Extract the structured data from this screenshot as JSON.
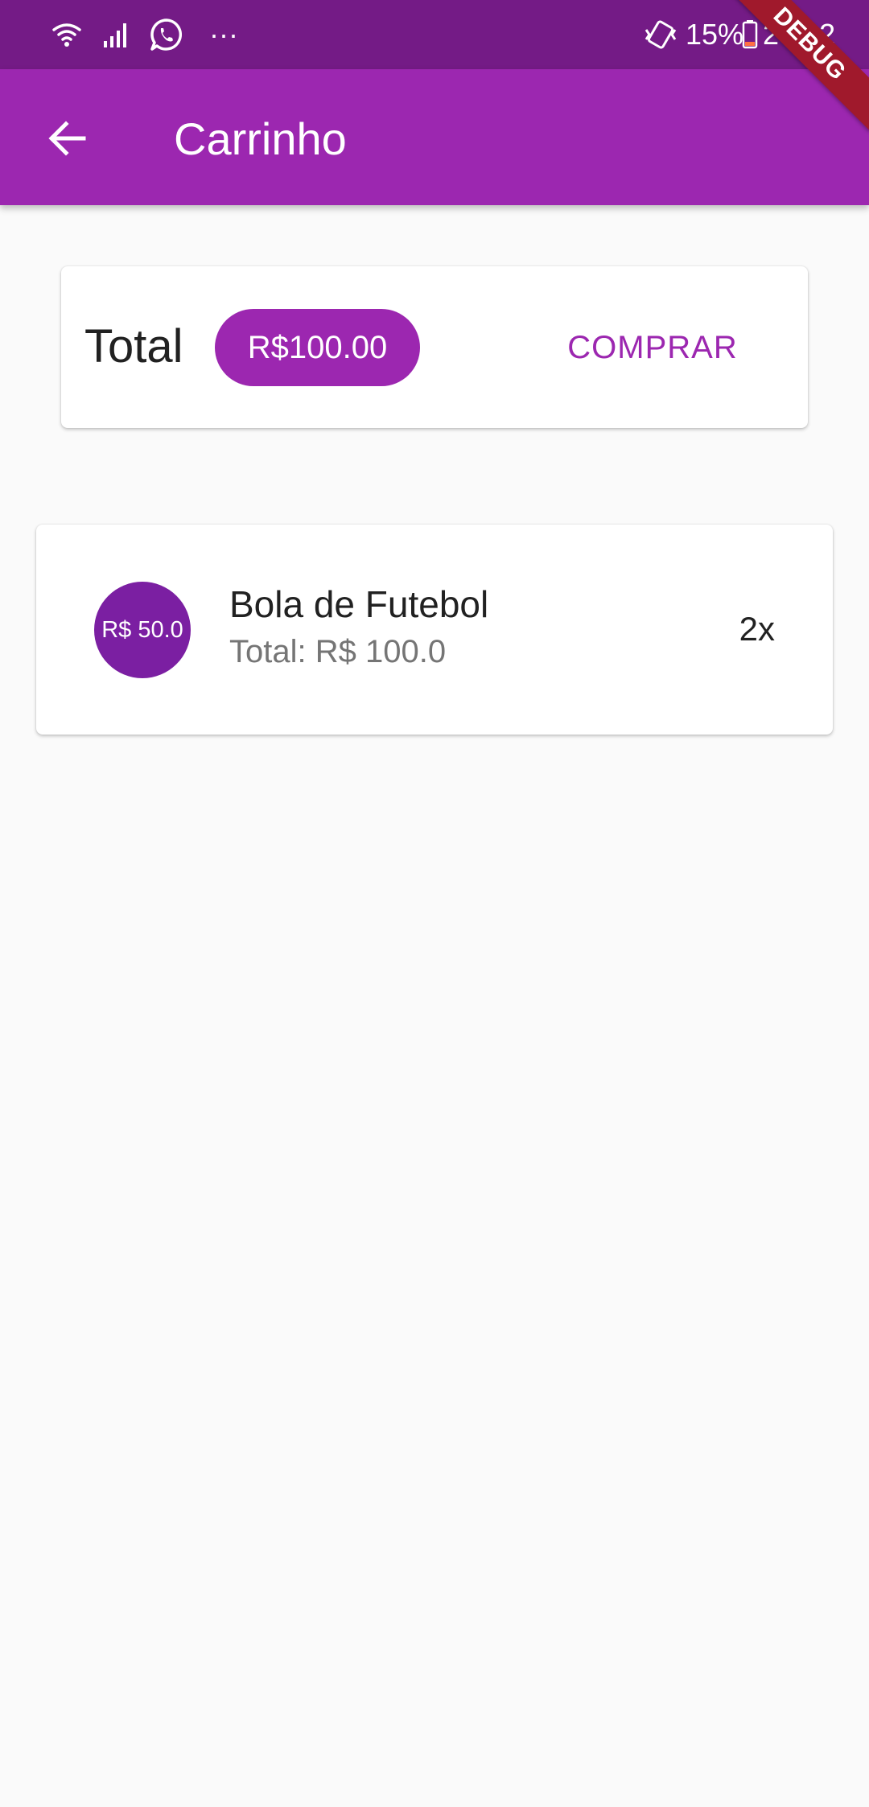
{
  "status_bar": {
    "icons": [
      "wifi-icon",
      "signal-icon",
      "whatsapp-icon",
      "more-notifications-icon",
      "vibrate-icon",
      "battery-icon"
    ],
    "more_indicator": "···",
    "battery_percent": "15%",
    "time": "20:32"
  },
  "debug_banner": "DEBUG",
  "app_bar": {
    "back_icon": "arrow-back-icon",
    "title": "Carrinho"
  },
  "total_card": {
    "label": "Total",
    "amount": "R$100.00",
    "buy_label": "COMPRAR"
  },
  "cart_items": [
    {
      "price_badge": "R$ 50.0",
      "name": "Bola de Futebol",
      "subtotal": "Total: R$ 100.0",
      "quantity": "2x"
    }
  ],
  "colors": {
    "primary": "#9c27b0",
    "primary_dark": "#741b86",
    "avatar": "#7b1fa2",
    "background": "#fafafa",
    "debug_ribbon": "#a0192c"
  }
}
